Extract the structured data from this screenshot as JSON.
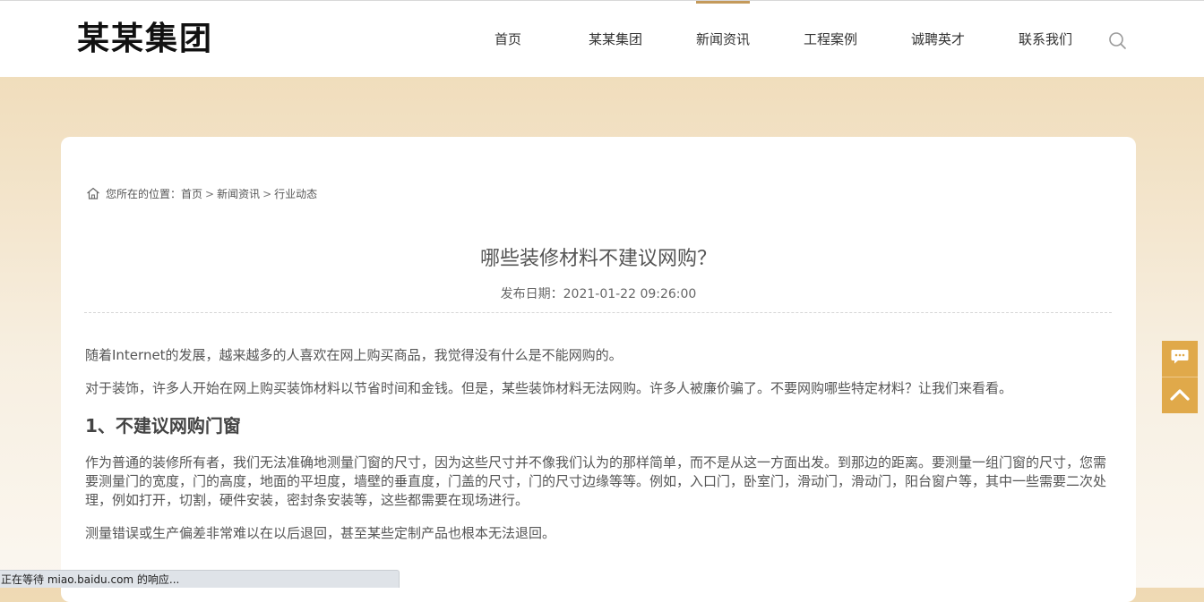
{
  "header": {
    "logo": "某某集团",
    "nav": [
      {
        "label": "首页",
        "active": false
      },
      {
        "label": "某某集团",
        "active": false
      },
      {
        "label": "新闻资讯",
        "active": true
      },
      {
        "label": "工程案例",
        "active": false
      },
      {
        "label": "诚聘英才",
        "active": false
      },
      {
        "label": "联系我们",
        "active": false
      }
    ],
    "search_icon": "search-icon"
  },
  "breadcrumb": {
    "prefix": "您所在的位置：",
    "items": [
      "首页",
      "新闻资讯",
      "行业动态"
    ],
    "separator": ">"
  },
  "article": {
    "title": "哪些装修材料不建议网购？",
    "date": "发布日期：2021-01-22 09:26:00",
    "paragraphs": [
      "随着Internet的发展，越来越多的人喜欢在网上购买商品，我觉得没有什么是不能网购的。",
      "对于装饰，许多人开始在网上购买装饰材料以节省时间和金钱。但是，某些装饰材料无法网购。许多人被廉价骗了。不要网购哪些特定材料？让我们来看看。"
    ],
    "heading": "1、不建议网购门窗",
    "body": [
      "作为普通的装修所有者，我们无法准确地测量门窗的尺寸，因为这些尺寸并不像我们认为的那样简单，而不是从这一方面出发。到那边的距离。要测量一组门窗的尺寸，您需要测量门的宽度，门的高度，地面的平坦度，墙壁的垂直度，门盖的尺寸，门的尺寸边缘等等。例如，入口门，卧室门，滑动门，滑动门，阳台窗户等，其中一些需要二次处理，例如打开，切割，硬件安装，密封条安装等，这些都需要在现场进行。",
      "测量错误或生产偏差非常难以在以后退回，甚至某些定制产品也根本无法退回。"
    ]
  },
  "side_tools": [
    "chat-icon",
    "back-to-top-icon"
  ],
  "status_bar": "正在等待 miao.baidu.com 的响应...",
  "colors": {
    "accent": "#c49a5b",
    "side_button": "#e0a94a"
  }
}
